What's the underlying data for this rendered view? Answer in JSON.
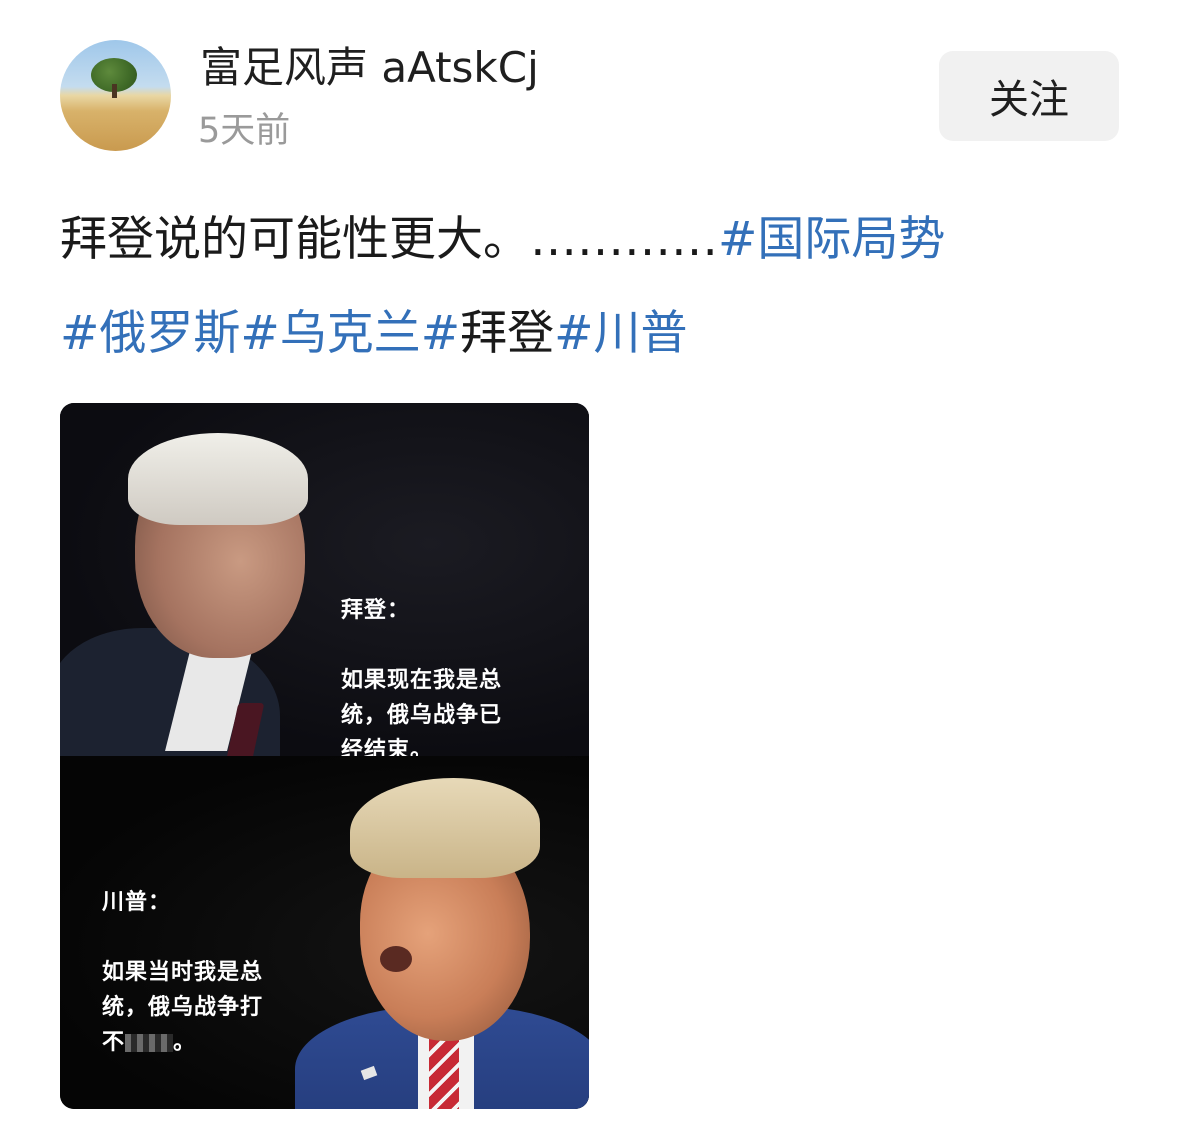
{
  "author": {
    "avatar_icon": "tree-landscape-avatar",
    "name": "富足风声 aAtskCj",
    "time": "5天前"
  },
  "follow_label": "关注",
  "post": {
    "text": "拜登说的可能性更大。…………",
    "hashtags_line1": [
      "#国际局势"
    ],
    "hashtags_line2": [
      {
        "text": "#俄罗斯",
        "linked": true
      },
      {
        "text": "#乌克兰",
        "linked": true
      },
      {
        "text": "#",
        "linked": true
      },
      {
        "text": "拜登",
        "linked": false
      },
      {
        "text": "#川普",
        "linked": true
      }
    ]
  },
  "image": {
    "top_caption": {
      "name": "拜登：",
      "quote": "如果现在我是总\n统，俄乌战争已\n经结束。"
    },
    "bottom_caption": {
      "name": "川普：",
      "quote": "如果当时我是总\n统，俄乌战争打\n不",
      "quote_end": "。"
    }
  },
  "colors": {
    "link": "#3370b9",
    "time": "#9a9a9a",
    "follow_bg": "#f1f1f1"
  }
}
